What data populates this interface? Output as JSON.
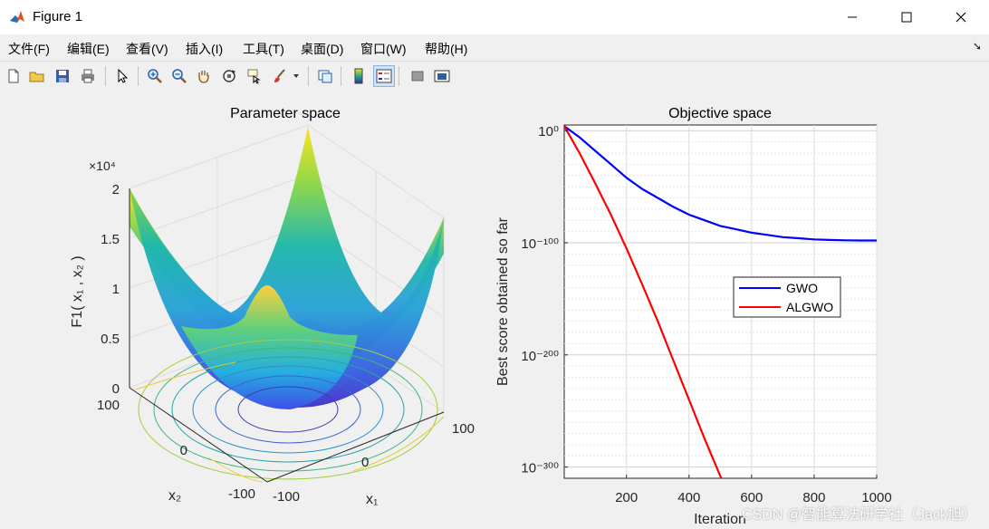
{
  "window": {
    "title": "Figure 1"
  },
  "menu": [
    "文件(F)",
    "编辑(E)",
    "查看(V)",
    "插入(I)",
    "工具(T)",
    "桌面(D)",
    "窗口(W)",
    "帮助(H)"
  ],
  "toolbar_icons": [
    "new-figure-icon",
    "open-file-icon",
    "save-icon",
    "print-icon",
    "pointer-icon",
    "zoom-in-icon",
    "zoom-out-icon",
    "pan-hand-icon",
    "rotate-3d-icon",
    "data-cursor-icon",
    "brush-icon",
    "brush-dropdown-icon",
    "link-plot-icon",
    "colorbar-icon",
    "legend-icon",
    "hide-plot-tools-icon",
    "show-plot-tools-icon"
  ],
  "left_plot": {
    "title": "Parameter space",
    "zlabel": "F1( x₁ , x₂ )",
    "z_exponent": "×10⁴",
    "z_ticks": [
      "2",
      "1.5",
      "1",
      "0.5",
      "0"
    ],
    "x1_label": "x₁",
    "x2_label": "x₂",
    "x1_ticks": [
      "-100",
      "0",
      "100"
    ],
    "x2_ticks": [
      "100",
      "0",
      "-100"
    ]
  },
  "chart_data": {
    "type": "line",
    "title": "Objective space",
    "xlabel": "Iteration",
    "ylabel": "Best score obtained so far",
    "x_ticks": [
      200,
      400,
      600,
      800,
      1000
    ],
    "y_ticks": [
      "10⁰",
      "10⁻¹⁰⁰",
      "10⁻²⁰⁰",
      "10⁻³⁰⁰"
    ],
    "xlim": [
      1,
      1000
    ],
    "ylim_log10": [
      -310,
      5
    ],
    "yscale": "log",
    "grid": true,
    "legend_position": "center-right",
    "series": [
      {
        "name": "GWO",
        "color": "#0000ff",
        "x": [
          1,
          50,
          100,
          150,
          200,
          250,
          300,
          350,
          400,
          450,
          500,
          550,
          600,
          650,
          700,
          750,
          800,
          850,
          900,
          950,
          1000
        ],
        "log10_y": [
          4,
          -6,
          -18,
          -30,
          -42,
          -52,
          -60,
          -68,
          -75,
          -80,
          -85,
          -88,
          -91,
          -93,
          -95,
          -96,
          -97,
          -97.5,
          -97.8,
          -98,
          -98
        ]
      },
      {
        "name": "ALGWO",
        "color": "#ff0000",
        "x": [
          1,
          50,
          100,
          150,
          200,
          250,
          300,
          350,
          400,
          450,
          500,
          515
        ],
        "log10_y": [
          4,
          -20,
          -47,
          -75,
          -105,
          -137,
          -170,
          -205,
          -240,
          -275,
          -308,
          -318
        ]
      }
    ]
  },
  "watermark": "CSDN @智能算法研学社（Jack旭）"
}
